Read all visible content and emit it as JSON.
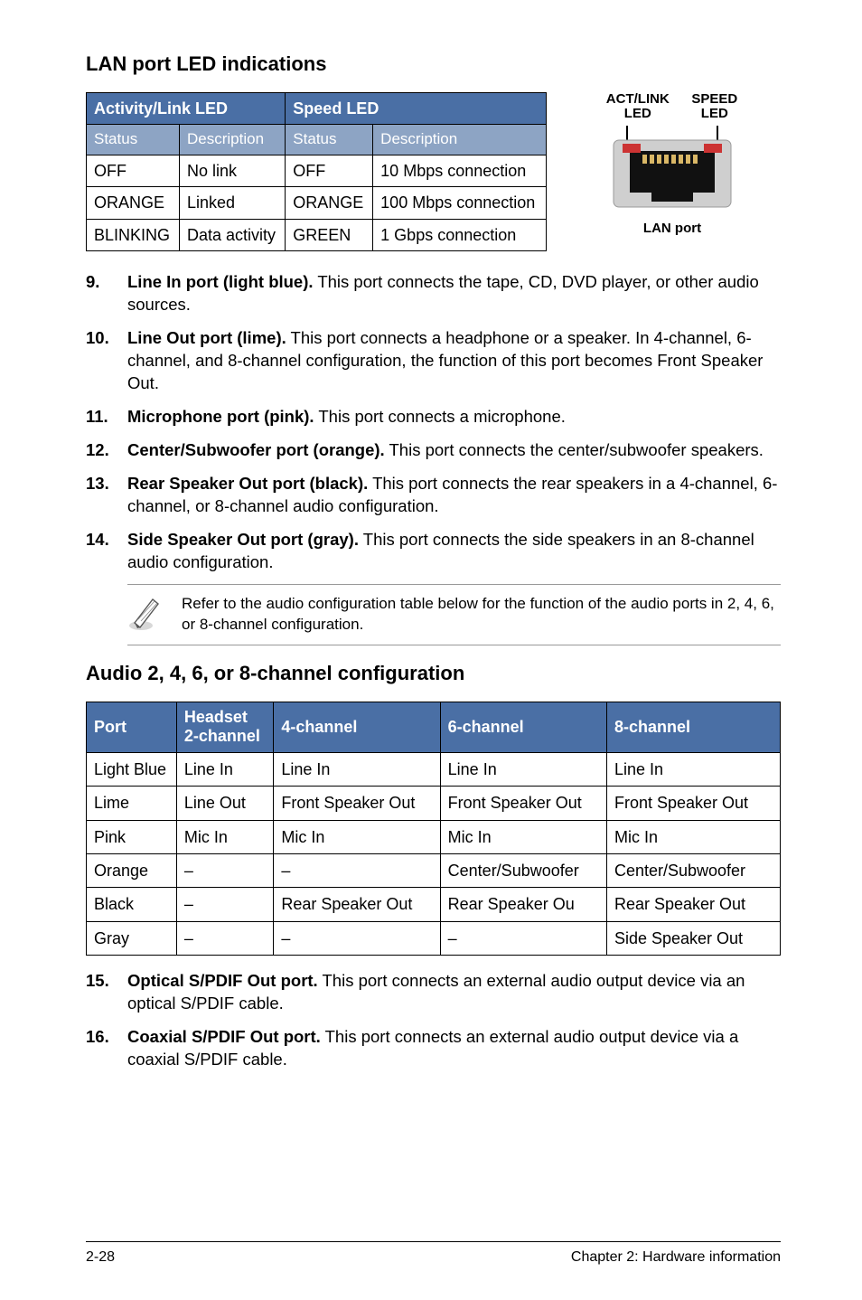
{
  "lan": {
    "heading": "LAN port LED indications",
    "headers": {
      "activity": "Activity/Link LED",
      "speed": "Speed LED",
      "status": "Status",
      "description": "Description"
    },
    "rows": [
      {
        "a_status": "OFF",
        "a_desc": "No link",
        "s_status": "OFF",
        "s_desc": "10 Mbps connection"
      },
      {
        "a_status": "ORANGE",
        "a_desc": "Linked",
        "s_status": "ORANGE",
        "s_desc": "100 Mbps connection"
      },
      {
        "a_status": "BLINKING",
        "a_desc": "Data activity",
        "s_status": "GREEN",
        "s_desc": "1 Gbps connection"
      }
    ],
    "figure": {
      "act_label": "ACT/LINK LED",
      "speed_label": "SPEED LED",
      "caption": "LAN port"
    }
  },
  "items": [
    {
      "n": "9.",
      "bold": "Line In port (light blue).",
      "rest": " This port connects the tape, CD, DVD player, or other audio sources."
    },
    {
      "n": "10.",
      "bold": "Line Out port (lime).",
      "rest": " This port connects a headphone or a speaker. In 4-channel, 6-channel, and 8-channel configuration, the function of this port becomes Front Speaker Out."
    },
    {
      "n": "11.",
      "bold": "Microphone port (pink).",
      "rest": " This port connects a microphone."
    },
    {
      "n": "12.",
      "bold": "Center/Subwoofer port (orange).",
      "rest": " This port connects the center/subwoofer speakers."
    },
    {
      "n": "13.",
      "bold": "Rear Speaker Out port (black).",
      "rest": " This port connects the rear speakers in a 4-channel, 6-channel, or 8-channel audio configuration."
    },
    {
      "n": "14.",
      "bold": "Side Speaker Out port (gray).",
      "rest": " This port connects the side speakers in an 8-channel audio configuration."
    }
  ],
  "note": "Refer to the audio configuration table below for the function of the audio ports in 2, 4, 6, or 8-channel configuration.",
  "audio": {
    "heading": "Audio 2, 4, 6, or 8-channel configuration",
    "headers": {
      "port": "Port",
      "c2a": "Headset",
      "c2b": "2-channel",
      "c4": "4-channel",
      "c6": "6-channel",
      "c8": "8-channel"
    },
    "rows": [
      {
        "port": "Light Blue",
        "c2": "Line In",
        "c4": "Line In",
        "c6": "Line In",
        "c8": "Line In"
      },
      {
        "port": "Lime",
        "c2": "Line Out",
        "c4": "Front Speaker Out",
        "c6": "Front Speaker Out",
        "c8": "Front Speaker Out"
      },
      {
        "port": "Pink",
        "c2": "Mic In",
        "c4": "Mic In",
        "c6": "Mic In",
        "c8": "Mic In"
      },
      {
        "port": "Orange",
        "c2": "–",
        "c4": "–",
        "c6": "Center/Subwoofer",
        "c8": "Center/Subwoofer"
      },
      {
        "port": "Black",
        "c2": "–",
        "c4": "Rear Speaker Out",
        "c6": "Rear Speaker Ou",
        "c8": "Rear Speaker Out"
      },
      {
        "port": "Gray",
        "c2": "–",
        "c4": "–",
        "c6": "–",
        "c8": "Side Speaker Out"
      }
    ]
  },
  "items2": [
    {
      "n": "15.",
      "bold": "Optical S/PDIF Out port.",
      "rest": " This port connects an external audio output device via an optical S/PDIF cable."
    },
    {
      "n": "16.",
      "bold": "Coaxial S/PDIF Out port.",
      "rest": " This port connects an external audio output device via a coaxial S/PDIF cable."
    }
  ],
  "footer": {
    "left": "2-28",
    "right": "Chapter 2: Hardware information"
  }
}
